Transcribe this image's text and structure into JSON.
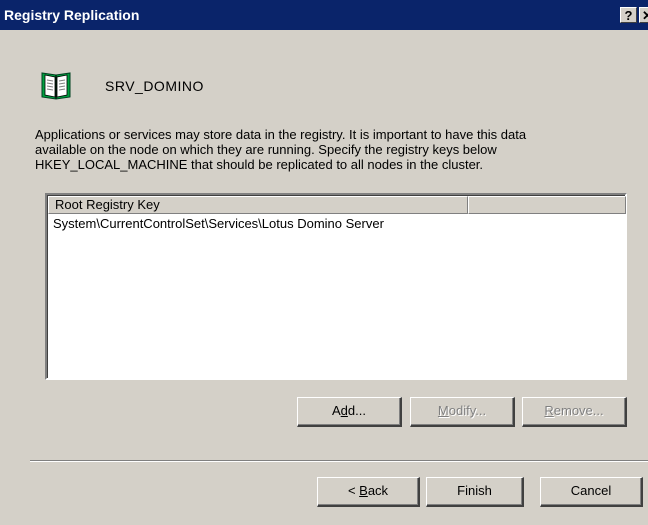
{
  "window": {
    "title": "Registry Replication",
    "help_glyph": "?",
    "close_glyph": "✕"
  },
  "resource": {
    "name": "SRV_DOMINO",
    "icon": "book-icon"
  },
  "description": {
    "lines": [
      "Applications or services may store data in the registry. It is important to have this data",
      "available on the node on which they are running. Specify the registry keys below",
      "HKEY_LOCAL_MACHINE that should be replicated to all nodes in the cluster."
    ]
  },
  "registry_list": {
    "columns": [
      "Root Registry Key",
      ""
    ],
    "rows": [
      "System\\CurrentControlSet\\Services\\Lotus Domino Server"
    ]
  },
  "list_buttons": {
    "add": {
      "pre": "A",
      "accel": "d",
      "post": "d..."
    },
    "modify": {
      "pre": "",
      "accel": "M",
      "post": "odify..."
    },
    "remove": {
      "pre": "",
      "accel": "R",
      "post": "emove..."
    }
  },
  "wizard_buttons": {
    "back": {
      "pre": "< ",
      "accel": "B",
      "post": "ack"
    },
    "finish": "Finish",
    "cancel": "Cancel"
  },
  "colors": {
    "titlebar": "#0a246a",
    "face": "#d4d0c8",
    "disabled_text": "#808080"
  }
}
